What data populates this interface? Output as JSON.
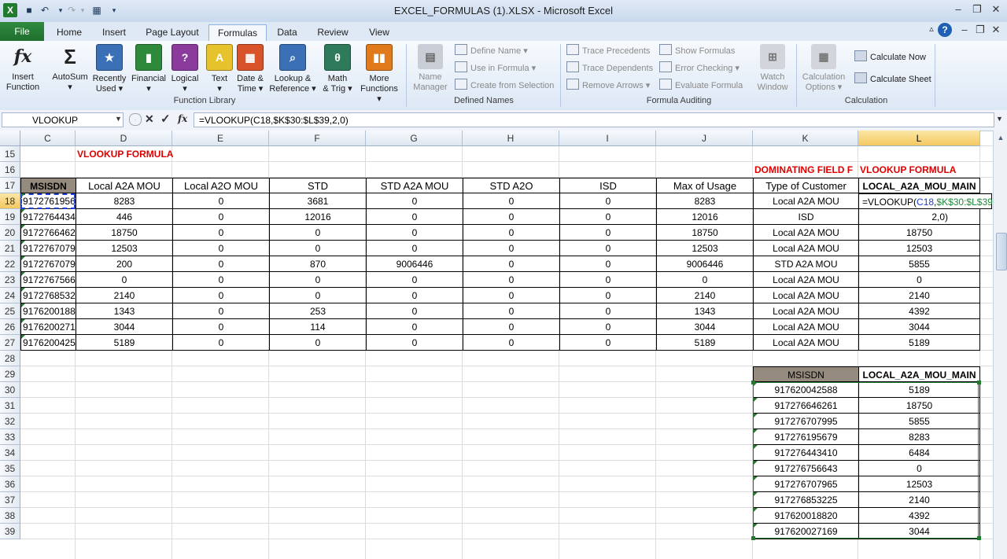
{
  "window": {
    "title": "EXCEL_FORMULAS (1).XLSX  -  Microsoft Excel"
  },
  "tabs": [
    "File",
    "Home",
    "Insert",
    "Page Layout",
    "Formulas",
    "Data",
    "Review",
    "View"
  ],
  "ribbon": {
    "function_library": {
      "label": "Function Library",
      "insert_function": [
        "Insert",
        "Function"
      ],
      "buttons": [
        {
          "l1": "AutoSum",
          "l2": "▾",
          "icon": "sigma-icon"
        },
        {
          "l1": "Recently",
          "l2": "Used ▾",
          "icon": "star-book-icon"
        },
        {
          "l1": "Financial",
          "l2": "▾",
          "icon": "financial-book-icon"
        },
        {
          "l1": "Logical",
          "l2": "▾",
          "icon": "logical-book-icon"
        },
        {
          "l1": "Text",
          "l2": "▾",
          "icon": "text-book-icon"
        },
        {
          "l1": "Date &",
          "l2": "Time ▾",
          "icon": "date-book-icon"
        },
        {
          "l1": "Lookup &",
          "l2": "Reference ▾",
          "icon": "lookup-book-icon"
        },
        {
          "l1": "Math",
          "l2": "& Trig ▾",
          "icon": "math-book-icon"
        },
        {
          "l1": "More",
          "l2": "Functions ▾",
          "icon": "more-books-icon"
        }
      ]
    },
    "defined_names": {
      "label": "Defined Names",
      "name_manager": [
        "Name",
        "Manager"
      ],
      "define_name": "Define Name ▾",
      "use_in_formula": "Use in Formula ▾",
      "create_from_selection": "Create from Selection"
    },
    "formula_auditing": {
      "label": "Formula Auditing",
      "trace_precedents": "Trace Precedents",
      "trace_dependents": "Trace Dependents",
      "remove_arrows": "Remove Arrows ▾",
      "show_formulas": "Show Formulas",
      "error_checking": "Error Checking ▾",
      "evaluate_formula": "Evaluate Formula",
      "watch_window": [
        "Watch",
        "Window"
      ]
    },
    "calculation": {
      "label": "Calculation",
      "calculation_options": [
        "Calculation",
        "Options ▾"
      ],
      "calculate_now": "Calculate Now",
      "calculate_sheet": "Calculate Sheet"
    }
  },
  "formula_bar": {
    "name_box": "VLOOKUP",
    "fx": "fx",
    "formula": "=VLOOKUP(C18,$K$30:$L$39,2,0)"
  },
  "columns": [
    "C",
    "D",
    "E",
    "F",
    "G",
    "H",
    "I",
    "J",
    "K",
    "L"
  ],
  "rows": [
    "15",
    "16",
    "17",
    "18",
    "19",
    "20",
    "21",
    "22",
    "23",
    "24",
    "25",
    "26",
    "27",
    "28",
    "29",
    "30",
    "31",
    "32",
    "33",
    "34",
    "35",
    "36",
    "37",
    "38",
    "39"
  ],
  "sheet": {
    "title_d15": "VLOOKUP FORMULA",
    "title_k16": "DOMINATING FIELD F",
    "title_l16": "VLOOKUP FORMULA",
    "headers": [
      "MSISDN",
      "Local A2A MOU",
      "Local A2O MOU",
      "STD",
      "STD A2A  MOU",
      "STD A2O",
      "ISD",
      "Max of Usage",
      "Type of Customer",
      "LOCAL_A2A_MOU_MAIN"
    ],
    "data": [
      [
        "9172761956",
        "8283",
        "0",
        "3681",
        "0",
        "0",
        "0",
        "8283",
        "Local A2A MOU",
        ""
      ],
      [
        "9172764434",
        "446",
        "0",
        "12016",
        "0",
        "0",
        "0",
        "12016",
        "ISD",
        "2,0)"
      ],
      [
        "9172766462",
        "18750",
        "0",
        "0",
        "0",
        "0",
        "0",
        "18750",
        "Local A2A MOU",
        "18750"
      ],
      [
        "9172767079",
        "12503",
        "0",
        "0",
        "0",
        "0",
        "0",
        "12503",
        "Local A2A MOU",
        "12503"
      ],
      [
        "9172767079",
        "200",
        "0",
        "870",
        "9006446",
        "0",
        "0",
        "9006446",
        "STD A2A  MOU",
        "5855"
      ],
      [
        "9172767566",
        "0",
        "0",
        "0",
        "0",
        "0",
        "0",
        "0",
        "Local A2A MOU",
        "0"
      ],
      [
        "9172768532",
        "2140",
        "0",
        "0",
        "0",
        "0",
        "0",
        "2140",
        "Local A2A MOU",
        "2140"
      ],
      [
        "9176200188",
        "1343",
        "0",
        "253",
        "0",
        "0",
        "0",
        "1343",
        "Local A2A MOU",
        "4392"
      ],
      [
        "9176200271",
        "3044",
        "0",
        "114",
        "0",
        "0",
        "0",
        "3044",
        "Local A2A MOU",
        "3044"
      ],
      [
        "9176200425",
        "5189",
        "0",
        "0",
        "0",
        "0",
        "0",
        "5189",
        "Local A2A MOU",
        "5189"
      ]
    ],
    "l18_edit": {
      "p1": "=VLOOKUP(",
      "p2": "C18",
      "p3": ",",
      "p4": "$K$30:$L$39",
      "p5": ","
    },
    "lookup_headers": [
      "MSISDN",
      "LOCAL_A2A_MOU_MAIN"
    ],
    "lookup": [
      [
        "917620042588",
        "5189"
      ],
      [
        "917276646261",
        "18750"
      ],
      [
        "917276707995",
        "5855"
      ],
      [
        "917276195679",
        "8283"
      ],
      [
        "917276443410",
        "6484"
      ],
      [
        "917276756643",
        "0"
      ],
      [
        "917276707965",
        "12503"
      ],
      [
        "917276853225",
        "2140"
      ],
      [
        "917620018820",
        "4392"
      ],
      [
        "917620027169",
        "3044"
      ]
    ]
  },
  "colors": {
    "accent_green": "#207b2f",
    "title_red": "#e00000",
    "ribbon_blue": "#dce7f5",
    "selected_header": "#f4c860",
    "formula_blue": "#1f3fd1",
    "formula_green": "#1e8a3a"
  }
}
